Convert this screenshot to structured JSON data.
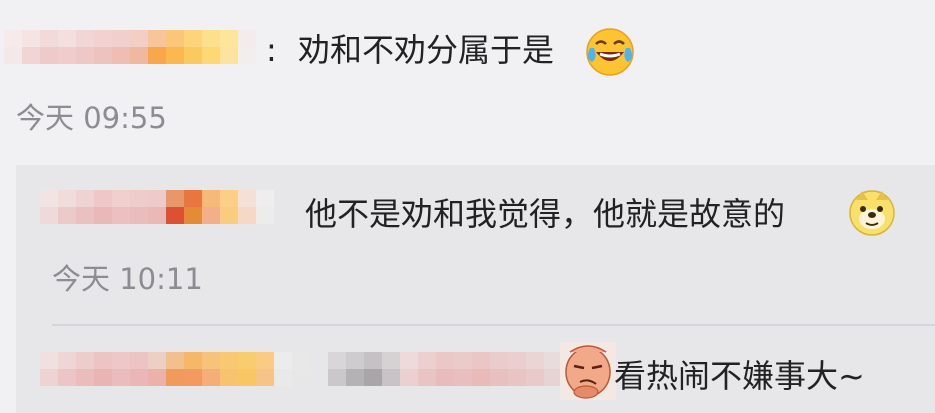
{
  "comment": {
    "separator": ":",
    "text": "劝和不劝分属于是",
    "emoji": "laugh-cry-icon",
    "time": "今天 09:55"
  },
  "reply": {
    "text": "他不是劝和我觉得，他就是故意的",
    "emoji": "doge-icon",
    "time": "今天 10:11"
  },
  "sub_reply": {
    "text": "看热闹不嫌事大~",
    "emoji": "sneer-sticker-icon"
  },
  "colors": {
    "background": "#f1f1f4",
    "reply_background": "#e7e7ea",
    "text": "#222222",
    "time": "#8c8c92"
  }
}
